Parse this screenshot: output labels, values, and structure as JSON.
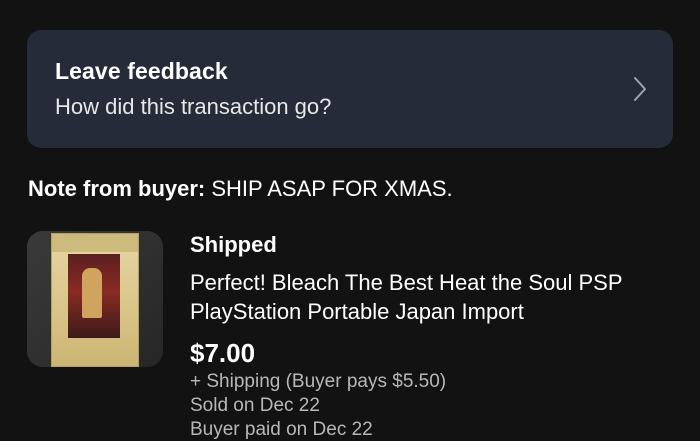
{
  "feedback": {
    "title": "Leave feedback",
    "subtitle": "How did this transaction go?",
    "icon": "chevron-right-icon"
  },
  "note": {
    "label": "Note from buyer:",
    "text": "SHIP ASAP FOR XMAS."
  },
  "order": {
    "status": "Shipped",
    "item_title": "Perfect! Bleach The Best Heat the Soul PSP PlayStation Portable Japan Import",
    "price": "$7.00",
    "shipping": "+ Shipping (Buyer pays $5.50)",
    "sold_on": "Sold on Dec 22",
    "buyer_paid": "Buyer paid on Dec 22"
  },
  "colors": {
    "background": "#121212",
    "card": "#252b39",
    "secondary_text": "#b8b8b8"
  }
}
